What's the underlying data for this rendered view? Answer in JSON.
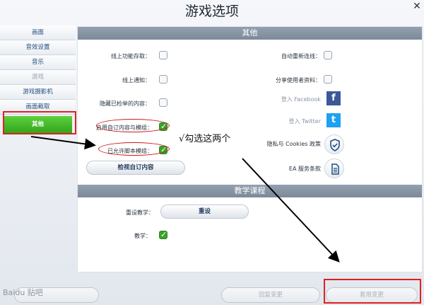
{
  "window": {
    "title": "游戏选项",
    "close_icon": "close-icon"
  },
  "sidebar": {
    "items": [
      {
        "label": "画面"
      },
      {
        "label": "音效设置"
      },
      {
        "label": "音乐"
      },
      {
        "label": "游戏"
      },
      {
        "label": "游戏摄影机"
      },
      {
        "label": "画面截取"
      },
      {
        "label": "其他"
      }
    ],
    "active_index": 6,
    "dim_index": 3
  },
  "other_section": {
    "header": "其他",
    "left": [
      {
        "label": "线上功能存取：",
        "checked": false
      },
      {
        "label": "线上通知：",
        "checked": false
      },
      {
        "label": "隐藏已检举的内容：",
        "checked": false
      },
      {
        "label": "启用自订内容与模组：",
        "checked": true
      },
      {
        "label": "已允许脚本模组：",
        "checked": true
      }
    ],
    "right": [
      {
        "label": "自动重新连线：",
        "checked": false
      },
      {
        "label": "分享使用者资料：",
        "checked": false
      }
    ],
    "facebook_label": "登入 Facebook",
    "twitter_label": "登入 Twitter",
    "privacy_label": "隐私与 Cookies 政策",
    "terms_label": "EA 服务条款",
    "view_custom_button": "检视自订内容",
    "colors": {
      "facebook": "#3b5998",
      "twitter": "#1da1f2",
      "checked": "#3aa22a"
    }
  },
  "tutorial_section": {
    "header": "教学课程",
    "reset_label": "重设教学：",
    "reset_button": "重设",
    "tutorial_label": "教学：",
    "tutorial_checked": true
  },
  "footer": {
    "left_button": "",
    "revert_button": "回复变更",
    "apply_button": "套用变更"
  },
  "annotation": {
    "text": "√勾选这两个"
  },
  "watermark": {
    "text": "Baidu 贴吧"
  }
}
